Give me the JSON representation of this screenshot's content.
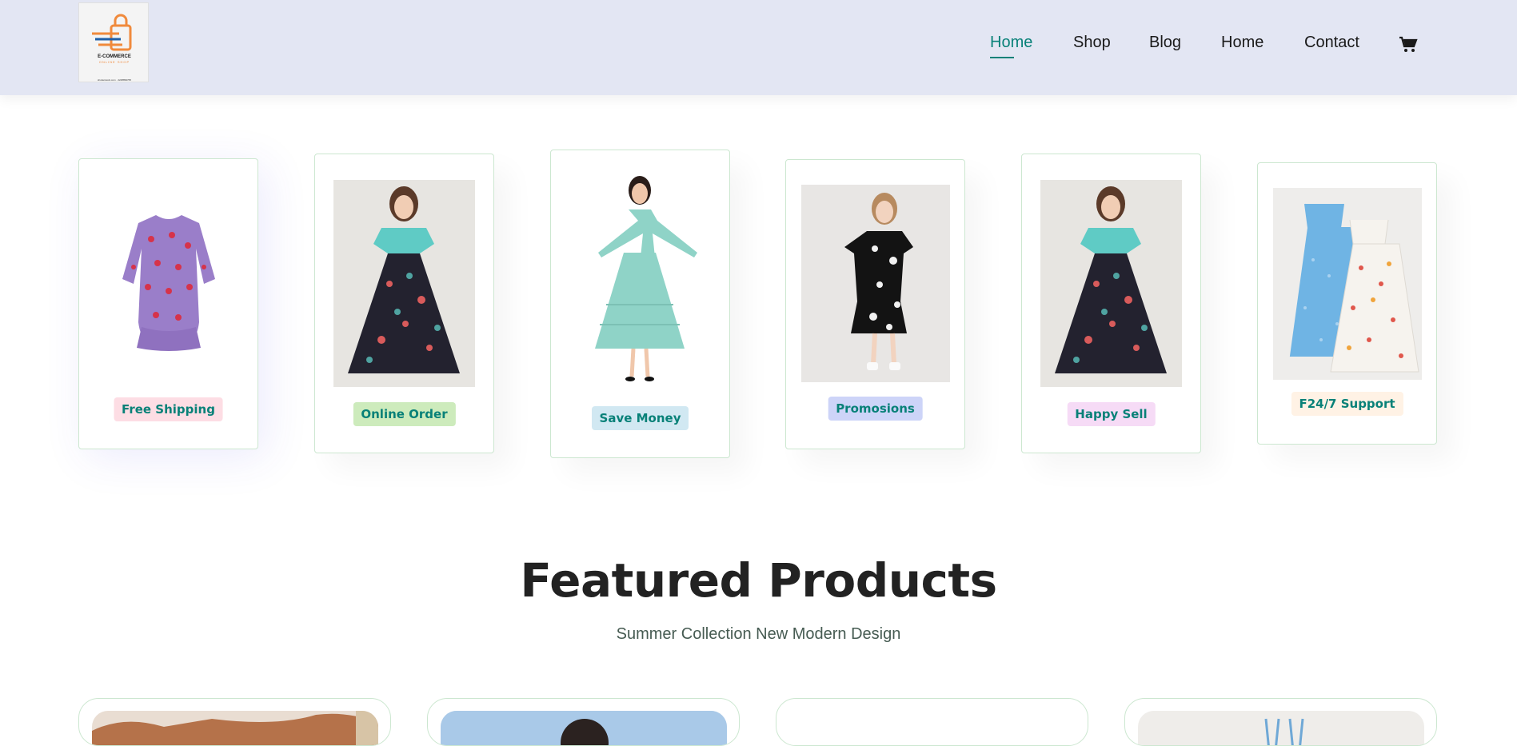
{
  "header": {
    "logo": {
      "title": "E-COMMERCE",
      "subtitle": "ONLINE SHOP",
      "footer": "shutterstock.com · 2248899765"
    },
    "nav": [
      {
        "label": "Home",
        "active": true
      },
      {
        "label": "Shop",
        "active": false
      },
      {
        "label": "Blog",
        "active": false
      },
      {
        "label": "Home",
        "active": false
      },
      {
        "label": "Contact",
        "active": false
      }
    ],
    "cart_icon": "shopping-cart-icon"
  },
  "features": [
    {
      "label": "Free Shipping",
      "bg": "#fddde4",
      "image": "purple-floral-dress"
    },
    {
      "label": "Online Order",
      "bg": "#cdebbc",
      "image": "teal-top-dark-skirt"
    },
    {
      "label": "Save Money",
      "bg": "#d1e8f2",
      "image": "mint-tiered-dress"
    },
    {
      "label": "Promosions",
      "bg": "#cdd4f8",
      "image": "black-floral-dress"
    },
    {
      "label": "Happy Sell",
      "bg": "#f6dbf6",
      "image": "teal-top-dark-skirt"
    },
    {
      "label": "F24/7 Support",
      "bg": "#fff2e5",
      "image": "blue-white-sundresses"
    }
  ],
  "featured": {
    "title": "Featured Products",
    "subtitle": "Summer Collection New Modern Design"
  },
  "colors": {
    "accent": "#088178",
    "header_bg": "#e3e6f3",
    "border": "#cce7d0"
  }
}
